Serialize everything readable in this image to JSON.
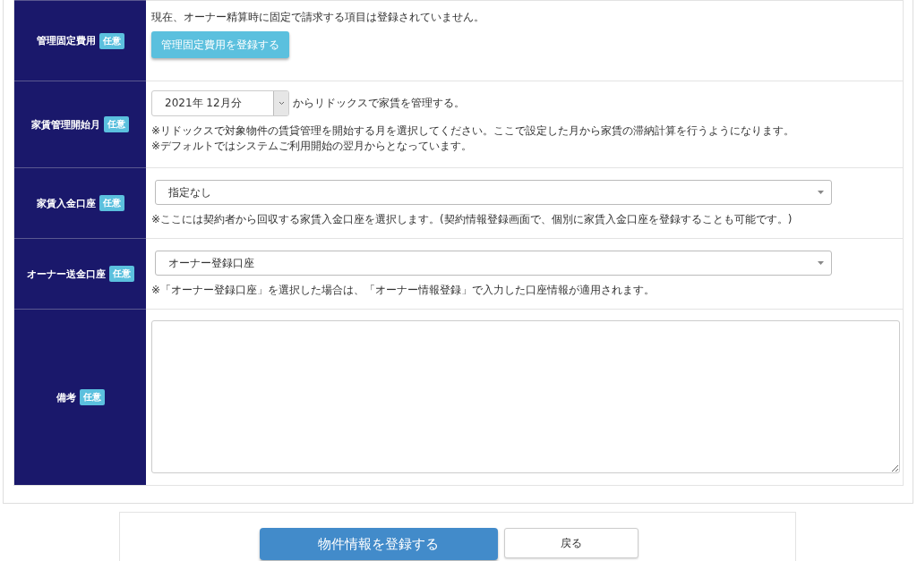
{
  "rows": [
    {
      "kind": "button",
      "label": "管理固定費用",
      "badge": "任意",
      "text": "現在、オーナー精算時に固定で請求する項目は登録されていません。",
      "button": "管理固定費用を登録する"
    },
    {
      "kind": "month_select",
      "label": "家賃管理開始月",
      "badge": "任意",
      "value": "2021年 12月分",
      "suffix": "からリドックスで家賃を管理する。",
      "notes": [
        "※リドックスで対象物件の賃貸管理を開始する月を選択してください。ここで設定した月から家賃の滞納計算を行うようになります。",
        "※デフォルトではシステムご利用開始の翌月からとなっています。"
      ]
    },
    {
      "kind": "select",
      "label": "家賃入金口座",
      "badge": "任意",
      "value": "指定なし",
      "notes": [
        "※ここには契約者から回収する家賃入金口座を選択します。(契約情報登録画面で、個別に家賃入金口座を登録することも可能です。)"
      ]
    },
    {
      "kind": "select",
      "label": "オーナー送金口座",
      "badge": "任意",
      "value": "オーナー登録口座",
      "notes": [
        "※「オーナー登録口座」を選択した場合は、「オーナー情報登録」で入力した口座情報が適用されます。"
      ]
    },
    {
      "kind": "textarea",
      "label": "備考",
      "badge": "任意"
    }
  ],
  "footer": {
    "submit": "物件情報を登録する",
    "back": "戻る"
  }
}
